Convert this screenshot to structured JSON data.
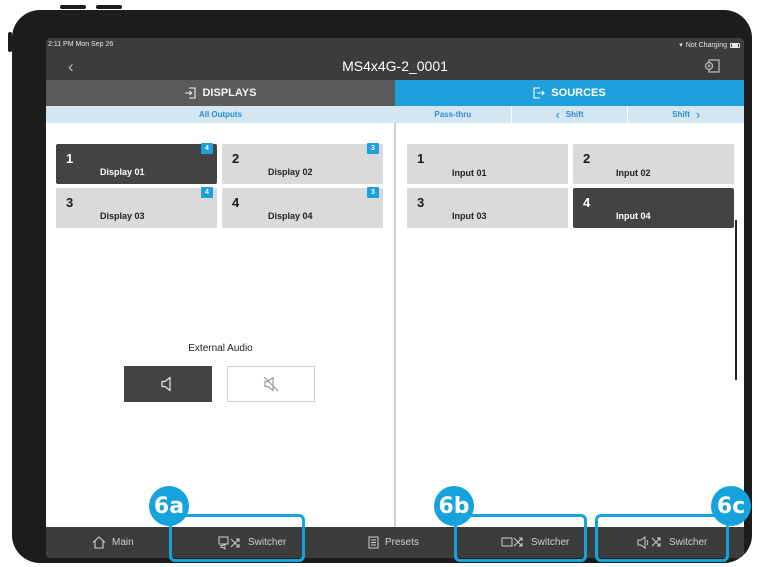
{
  "status": {
    "time": "2:11 PM  Mon Sep 26",
    "charging": "Not Charging"
  },
  "header": {
    "title": "MS4x4G-2_0001"
  },
  "tabs": {
    "displays": "DISPLAYS",
    "sources": "SOURCES"
  },
  "subbar": {
    "all_outputs": "All Outputs",
    "passthru": "Pass-thru",
    "shift_left": "Shift",
    "shift_right": "Shift"
  },
  "displays": [
    {
      "num": "1",
      "label": "Display 01",
      "badge": "4",
      "active": true
    },
    {
      "num": "2",
      "label": "Display 02",
      "badge": "3",
      "active": false
    },
    {
      "num": "3",
      "label": "Display 03",
      "badge": "4",
      "active": false
    },
    {
      "num": "4",
      "label": "Display 04",
      "badge": "3",
      "active": false
    }
  ],
  "sources": [
    {
      "num": "1",
      "label": "Input 01",
      "active": false
    },
    {
      "num": "2",
      "label": "Input 02",
      "active": false
    },
    {
      "num": "3",
      "label": "Input 03",
      "active": false
    },
    {
      "num": "4",
      "label": "Input 04",
      "active": true
    }
  ],
  "audio": {
    "label": "External Audio",
    "unmute_icon": "speaker-icon",
    "mute_icon": "speaker-muted-icon"
  },
  "nav": {
    "main": "Main",
    "av_switcher": "Switcher",
    "presets": "Presets",
    "video_switcher": "Switcher",
    "audio_switcher": "Switcher"
  },
  "callouts": {
    "a": "6a",
    "b": "6b",
    "c": "6c"
  },
  "colors": {
    "accent": "#1ea0dc",
    "callout": "#16a2dc",
    "bar": "#3c3c3c",
    "active_tile": "#434343"
  }
}
